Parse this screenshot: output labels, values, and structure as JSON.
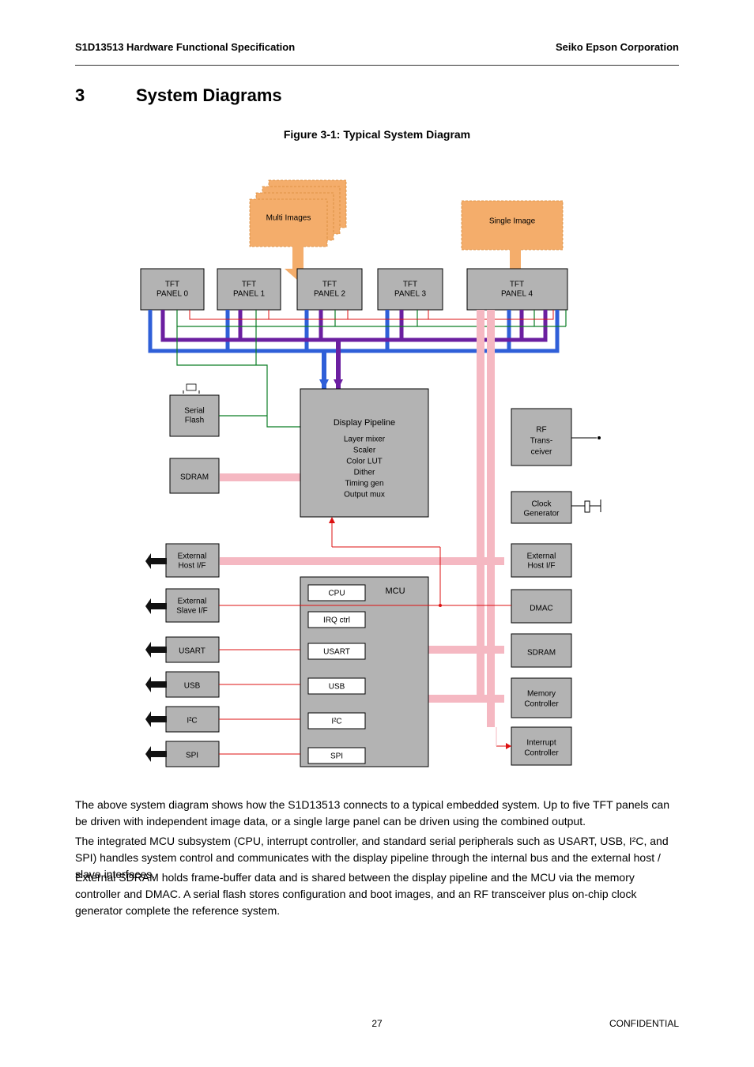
{
  "header": {
    "left": "S1D13513 Hardware Functional Specification",
    "right": "Seiko Epson Corporation"
  },
  "section": {
    "number": "3",
    "title": "System Diagrams"
  },
  "figure": {
    "caption": "Figure 3-1: Typical System Diagram"
  },
  "diagram": {
    "decor": {
      "multi": "Multi Images",
      "single": "Single Image"
    },
    "top": [
      {
        "l1": "TFT",
        "l2": "PANEL 0"
      },
      {
        "l1": "TFT",
        "l2": "PANEL 1"
      },
      {
        "l1": "TFT",
        "l2": "PANEL 2"
      },
      {
        "l1": "TFT",
        "l2": "PANEL 3"
      },
      {
        "l1": "TFT",
        "l2": "PANEL 4"
      }
    ],
    "lvcu": {
      "title": "Display Pipeline",
      "l1": "Layer mixer",
      "l2": "Scaler",
      "l3": "Color LUT",
      "l4": "Dither",
      "l5": "Timing gen",
      "l6": "Output mux"
    },
    "left": {
      "flash": {
        "l1": "Serial",
        "l2": "Flash"
      },
      "sdram": "SDRAM",
      "ehost": {
        "l1": "External",
        "l2": "Host I/F"
      },
      "eslave": {
        "l1": "External",
        "l2": "Slave I/F"
      },
      "usart": "USART",
      "usb": "USB",
      "i2c": "I²C",
      "spi": "SPI"
    },
    "mcu": {
      "title": "MCU",
      "items": [
        "CPU",
        "IRQ ctrl",
        "USART",
        "USB",
        "I²C",
        "SPI"
      ]
    },
    "right": {
      "rf": {
        "l1": "RF",
        "l2": "Trans-",
        "l3": "ceiver"
      },
      "clock": {
        "l1": "Clock",
        "l2": "Generator"
      },
      "ehost": {
        "l1": "External",
        "l2": "Host I/F"
      },
      "dmac": "DMAC",
      "sdram": "SDRAM",
      "memctrl": {
        "l1": "Memory",
        "l2": "Controller"
      },
      "intc": {
        "l1": "Interrupt",
        "l2": "Controller"
      }
    }
  },
  "body": {
    "p1": "The above system diagram shows how the S1D13513 connects to a typical embedded system. Up to five TFT panels can be driven with independent image data, or a single large panel can be driven using the combined output.",
    "p2": "The integrated MCU subsystem (CPU, interrupt controller, and standard serial peripherals such as USART, USB, I²C, and SPI) handles system control and communicates with the display pipeline through the internal bus and the external host / slave interfaces.",
    "p3": "External SDRAM holds frame-buffer data and is shared between the display pipeline and the MCU via the memory controller and DMAC. A serial flash stores configuration and boot images, and an RF transceiver plus on-chip clock generator complete the reference system."
  },
  "footer": {
    "label": "CONFIDENTIAL",
    "page": "27"
  }
}
